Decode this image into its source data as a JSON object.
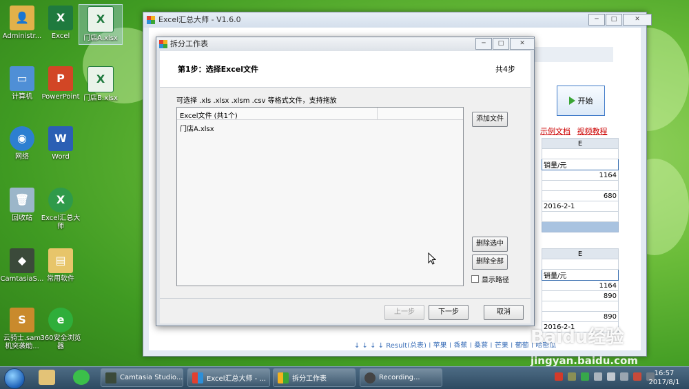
{
  "desktop": {
    "icons": [
      {
        "label": "Administr..."
      },
      {
        "label": "Excel"
      },
      {
        "label": "门店A.xlsx"
      },
      {
        "label": "计算机"
      },
      {
        "label": "PowerPoint"
      },
      {
        "label": "门店B.xlsx"
      },
      {
        "label": "网络"
      },
      {
        "label": "Word"
      },
      {
        "label": "回收站"
      },
      {
        "label": "Excel汇总大师"
      },
      {
        "label": "CamtasiaS..."
      },
      {
        "label": "常用软件"
      },
      {
        "label": "云骑士.sam 机突袭助..."
      },
      {
        "label": "360安全浏览器"
      }
    ]
  },
  "main_window": {
    "title": "Excel汇总大师 - V1.6.0",
    "start_label": "开始",
    "links": [
      "示例文档",
      "视频教程"
    ],
    "grid1": {
      "col": "E",
      "header": "销量/元",
      "v1": "1164",
      "v2": "680",
      "date": "2016-2-1"
    },
    "grid2": {
      "col": "E",
      "header": "销量/元",
      "v1": "1164",
      "v2": "890",
      "v3": "890",
      "date": "2016-2-1"
    },
    "status_text": "↓ ↓ ↓ ↓ Result(总表) | 苹果 | 香蕉 | 桑葚 | 芒果 | 葡萄 | 哈密瓜"
  },
  "dialog": {
    "title": "拆分工作表",
    "step_title": "第1步：选择Excel文件",
    "step_total": "共4步",
    "hint": "可选择 .xls  .xlsx  .xlsm .csv 等格式文件，支持拖放",
    "list_header": "Excel文件 (共1个)",
    "files": [
      "门店A.xlsx"
    ],
    "add_file": "添加文件",
    "delete_selected": "删除选中",
    "delete_all": "删除全部",
    "show_path": "显示路径",
    "prev": "上一步",
    "next": "下一步",
    "cancel": "取消"
  },
  "taskbar": {
    "items": [
      "Camtasia Studio...",
      "Excel汇总大师 - ...",
      "拆分工作表",
      "Recording..."
    ],
    "time": "16:57",
    "date": "2017/8/1"
  },
  "watermark": {
    "text": "Baidu经验",
    "url": "jingyan.baidu.com"
  }
}
